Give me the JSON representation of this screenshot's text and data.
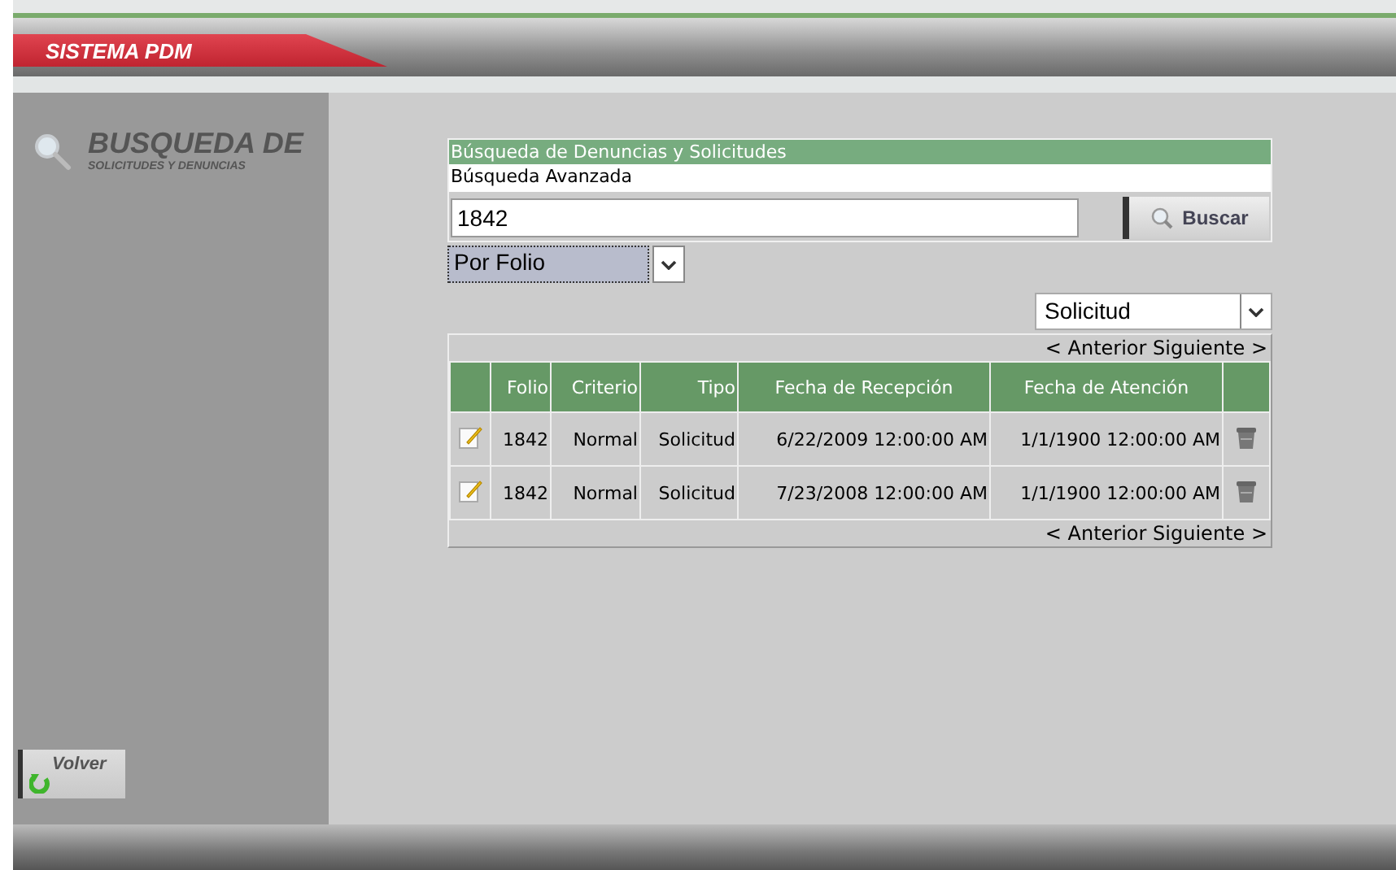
{
  "header": {
    "title": "SISTEMA PDM"
  },
  "sidebar": {
    "title": "BUSQUEDA DE",
    "subtitle": "SOLICITUDES Y DENUNCIAS",
    "back_button": "Volver"
  },
  "search": {
    "title": "Búsqueda de Denuncias y Solicitudes",
    "subtitle": "Búsqueda Avanzada",
    "query": "1842",
    "button": "Buscar",
    "criterion": "Por Folio",
    "type": "Solicitud"
  },
  "pager_top": {
    "previous": "< Anterior",
    "next": "Siguiente >"
  },
  "table": {
    "columns": [
      "Folio",
      "Criterio",
      "Tipo",
      "Fecha de Recepción",
      "Fecha de Atención"
    ],
    "rows": [
      {
        "folio": "1842",
        "criterio": "Normal",
        "tipo": "Solicitud",
        "recepcion": "6/22/2009 12:00:00 AM",
        "atencion": "1/1/1900 12:00:00 AM"
      },
      {
        "folio": "1842",
        "criterio": "Normal",
        "tipo": "Solicitud",
        "recepcion": "7/23/2008 12:00:00 AM",
        "atencion": "1/1/1900 12:00:00 AM"
      }
    ]
  },
  "pager_bottom": {
    "previous": "< Anterior",
    "next": "Siguiente >"
  }
}
